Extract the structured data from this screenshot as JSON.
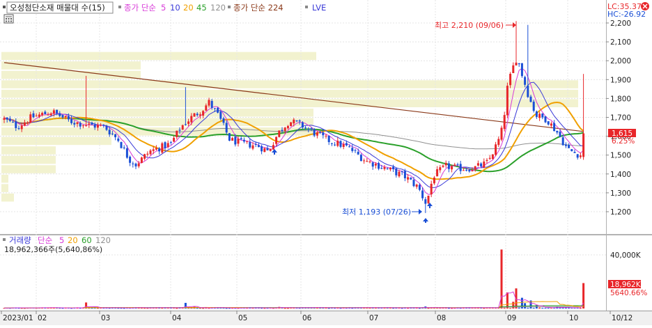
{
  "price_legend": {
    "title": "오성첨단소재 매물대 수(15)",
    "ma_prefix": "종가 단순",
    "ma_periods": [
      "5",
      "10",
      "20",
      "45",
      "120"
    ],
    "long_ma": "종가 단순 224",
    "lve": "LVE"
  },
  "volume_legend": {
    "title": "거래량",
    "ma_prefix": "단순",
    "ma_periods": [
      "5",
      "20",
      "60",
      "120"
    ],
    "value_text": "18,962,366주(5,640,86%)"
  },
  "lc_label": "LC:35.37",
  "hc_label": "HC:-26.92",
  "annotations": {
    "high": "최고 2,210 (09/06)",
    "low": "최저 1,193 (07/26)"
  },
  "current_price": {
    "label": "1,615",
    "pct": "6.25%"
  },
  "current_volume": {
    "label": "18,962K",
    "pct": "5640.66%"
  },
  "colors": {
    "up": "#e8262a",
    "down": "#1a4fd6",
    "ma5": "#d83ad8",
    "ma10": "#3a3ad8",
    "ma20": "#f0a000",
    "ma45": "#2aa02a",
    "ma120": "#909090",
    "ma224": "#8b3a1a",
    "volume_profile": "#f2f2cf"
  },
  "chart_data": [
    {
      "type": "candlestick",
      "title": "오성첨단소재 매물대 수(15)",
      "x_tick_labels": [
        "2023/01",
        "02",
        "03",
        "04",
        "05",
        "06",
        "07",
        "08",
        "09",
        "10",
        "10/12"
      ],
      "y_tick_labels": [
        "2,200",
        "2,100",
        "2,000",
        "1,900",
        "1,800",
        "1,700",
        "1,600",
        "1,500",
        "1,400",
        "1,300",
        "1,200"
      ],
      "ylim": [
        1140,
        2250
      ],
      "monthly_approx": [
        {
          "month": "01",
          "open": 1680,
          "high": 1740,
          "low": 1620,
          "close": 1700
        },
        {
          "month": "02",
          "open": 1700,
          "high": 1920,
          "low": 1580,
          "close": 1650
        },
        {
          "month": "03",
          "open": 1650,
          "high": 1700,
          "low": 1400,
          "close": 1560
        },
        {
          "month": "04",
          "open": 1560,
          "high": 1860,
          "low": 1550,
          "close": 1720
        },
        {
          "month": "05",
          "open": 1720,
          "high": 1730,
          "low": 1500,
          "close": 1540
        },
        {
          "month": "06",
          "open": 1560,
          "high": 1720,
          "low": 1560,
          "close": 1650
        },
        {
          "month": "07",
          "open": 1650,
          "high": 1660,
          "low": 1193,
          "close": 1260
        },
        {
          "month": "08",
          "open": 1280,
          "high": 1540,
          "low": 1280,
          "close": 1420
        },
        {
          "month": "09",
          "open": 1460,
          "high": 2210,
          "low": 1450,
          "close": 1800
        },
        {
          "month": "10",
          "open": 1700,
          "high": 1930,
          "low": 1470,
          "close": 1615
        }
      ],
      "high": {
        "value": 2210,
        "date": "09/06"
      },
      "low": {
        "value": 1193,
        "date": "07/26"
      },
      "last_close": 1615,
      "moving_averages": [
        "5",
        "10",
        "20",
        "45",
        "120",
        "224"
      ]
    },
    {
      "type": "bar",
      "title": "거래량",
      "y_tick_labels": [
        "40,000K"
      ],
      "last_value_k": 18962,
      "peaks": [
        {
          "period": "09 early",
          "value_k": 44000
        },
        {
          "period": "10/12",
          "value_k": 18962
        }
      ]
    }
  ]
}
